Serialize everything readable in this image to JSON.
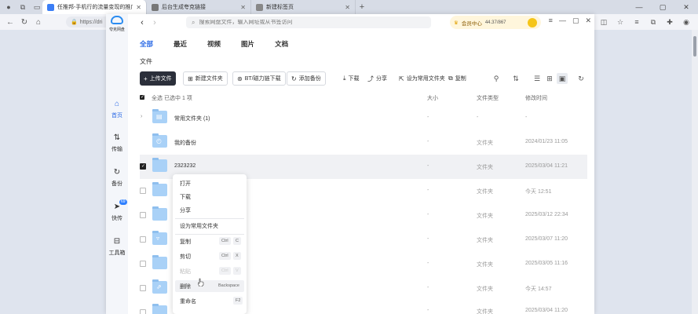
{
  "browser": {
    "tabs": [
      {
        "title": "任推邦-手机行的流量变现的推广平台",
        "color": "#3b7ef6",
        "active": true
      },
      {
        "title": "后台生成夸克链接",
        "color": "#777777",
        "active": false
      },
      {
        "title": "新建标签页",
        "color": "#888888",
        "active": false
      }
    ],
    "address": "https://dri",
    "controls": {
      "minimize": "—",
      "maximize": "▢",
      "close": "✕"
    }
  },
  "app": {
    "logo": "夸克网盘",
    "sidebar": [
      {
        "label": "首页",
        "icon": "home-icon",
        "active": true
      },
      {
        "label": "传输",
        "icon": "transfer-icon",
        "active": false
      },
      {
        "label": "备份",
        "icon": "backup-icon",
        "active": false
      },
      {
        "label": "快传",
        "icon": "quick-send-icon",
        "active": false,
        "badge": "69"
      },
      {
        "label": "工具箱",
        "icon": "toolbox-icon",
        "active": false
      }
    ],
    "search_placeholder": "搜索网盘文件，输入网址或从书签访问",
    "vip": {
      "label": "会员中心",
      "capacity": "44.37/867"
    },
    "tabs": [
      "全部",
      "最近",
      "视频",
      "图片",
      "文档"
    ],
    "active_tab": "全部",
    "breadcrumb": "文件",
    "actions": {
      "upload": "上传文件",
      "new_folder": "新建文件夹",
      "bt": "BT/磁力链下载",
      "backup": "添加备份",
      "download": "下载",
      "share": "分享",
      "set_common": "设为常用文件夹",
      "copy": "复制"
    },
    "table": {
      "select_all": "全选",
      "selected": "已选中 1 项",
      "columns": {
        "size": "大小",
        "type": "文件类型",
        "time": "修改时间"
      }
    },
    "rows": [
      {
        "name": "常用文件夹 (1)",
        "size": "-",
        "type": "-",
        "time": "-",
        "checked": false,
        "expand": true
      },
      {
        "name": "我的备份",
        "size": "-",
        "type": "文件夹",
        "time": "2024/01/23 11:05",
        "checked": false
      },
      {
        "name": "2323232",
        "size": "-",
        "type": "文件夹",
        "time": "2025/03/04 11:21",
        "checked": true
      },
      {
        "name": "",
        "size": "-",
        "type": "文件夹",
        "time": "今天 12:51",
        "checked": false
      },
      {
        "name": "",
        "size": "-",
        "type": "文件夹",
        "time": "2025/03/12 22:34",
        "checked": false
      },
      {
        "name": "",
        "size": "-",
        "type": "文件夹",
        "time": "2025/03/07 11:20",
        "checked": false
      },
      {
        "name": "",
        "size": "-",
        "type": "文件夹",
        "time": "2025/03/05 11:16",
        "checked": false
      },
      {
        "name": "",
        "size": "-",
        "type": "文件夹",
        "time": "今天 14:57",
        "checked": false
      },
      {
        "name": "",
        "size": "-",
        "type": "文件夹",
        "time": "2025/03/04 11:20",
        "checked": false
      }
    ],
    "context_menu": {
      "open": "打开",
      "download": "下载",
      "share": "分享",
      "set_common": "设为常用文件夹",
      "copy": "复制",
      "copy_key": [
        "Ctrl",
        "C"
      ],
      "cut": "剪切",
      "cut_key": [
        "Ctrl",
        "X"
      ],
      "paste": "粘贴",
      "paste_key": [
        "Ctrl",
        "V"
      ],
      "delete": "删除",
      "delete_key": "Backspace",
      "rename": "重命名",
      "rename_key": "F2"
    }
  }
}
